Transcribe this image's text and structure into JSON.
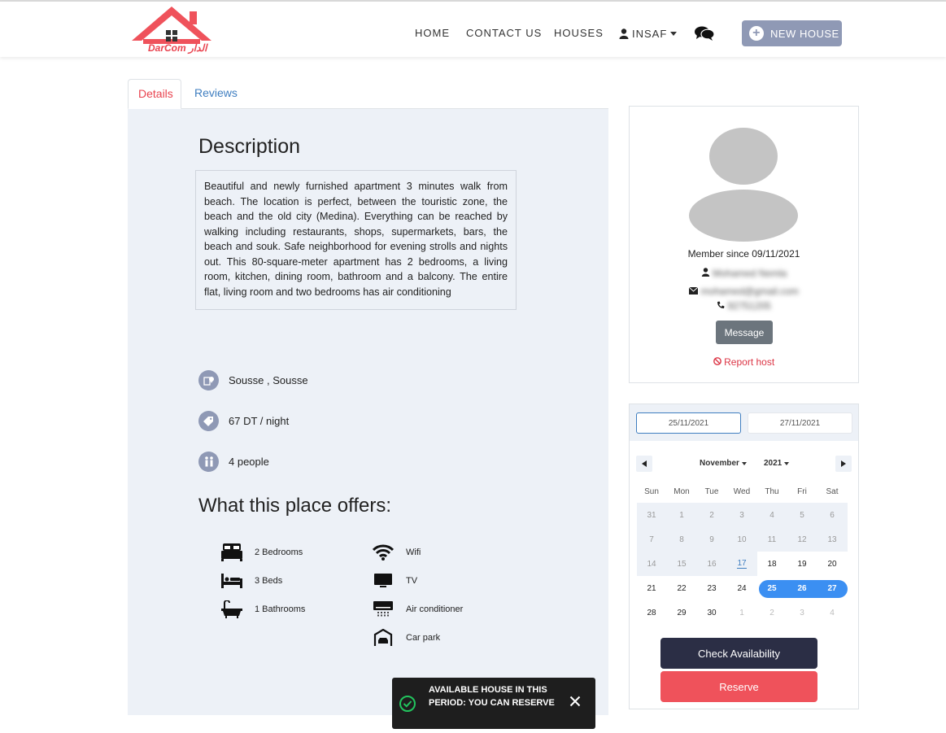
{
  "brand": {
    "logo_text": "DarCom الدار",
    "accent": "#e9434f"
  },
  "nav": {
    "home": "HOME",
    "contact": "CONTACT US",
    "houses": "HOUSES",
    "user": "INSAF",
    "new_house": "NEW HOUSE"
  },
  "tabs": {
    "details": "Details",
    "reviews": "Reviews"
  },
  "description": {
    "title": "Description",
    "text": "Beautiful and newly furnished apartment 3 minutes walk from beach. The location is perfect, between the touristic zone, the beach and the old city (Medina). Everything can be reached by walking including restaurants, shops, supermarkets, bars, the beach and souk. Safe neighborhood for evening strolls and nights out. This 80-square-meter apartment has 2 bedrooms, a living room, kitchen, dining room, bathroom and a balcony. The entire flat, living room and two bedrooms has air conditioning"
  },
  "info": {
    "location": "Sousse , Sousse",
    "price": "67 DT / night",
    "capacity": "4 people"
  },
  "offers": {
    "title": "What this place offers:",
    "left": [
      {
        "label": "2 Bedrooms",
        "icon": "bedroom-icon"
      },
      {
        "label": "3 Beds",
        "icon": "bed-icon"
      },
      {
        "label": "1 Bathrooms",
        "icon": "bathtub-icon"
      }
    ],
    "right": [
      {
        "label": "Wifi",
        "icon": "wifi-icon"
      },
      {
        "label": "TV",
        "icon": "tv-icon"
      },
      {
        "label": "Air conditioner",
        "icon": "air-conditioner-icon"
      },
      {
        "label": "Car park",
        "icon": "car-park-icon"
      }
    ]
  },
  "host": {
    "member_since": "Member since 09/11/2021",
    "name": "Mohamed Nemla",
    "email": "mohamed@gmail.com",
    "phone": "92751205",
    "message_btn": "Message",
    "report": "Report host"
  },
  "booking": {
    "start_date": "25/11/2021",
    "end_date": "27/11/2021",
    "month": "November",
    "year": "2021",
    "weekdays": [
      "Sun",
      "Mon",
      "Tue",
      "Wed",
      "Thu",
      "Fri",
      "Sat"
    ],
    "weeks": [
      [
        "31",
        "1",
        "2",
        "3",
        "4",
        "5",
        "6"
      ],
      [
        "7",
        "8",
        "9",
        "10",
        "11",
        "12",
        "13"
      ],
      [
        "14",
        "15",
        "16",
        "17",
        "18",
        "19",
        "20"
      ],
      [
        "21",
        "22",
        "23",
        "24",
        "25",
        "26",
        "27"
      ],
      [
        "28",
        "29",
        "30",
        "1",
        "2",
        "3",
        "4"
      ]
    ],
    "check_btn": "Check Availability",
    "reserve_btn": "Reserve",
    "selection_color": "#3b8ff2"
  },
  "toast": {
    "message": "AVAILABLE HOUSE IN THIS PERIOD: YOU CAN RESERVE",
    "status_color": "#22c55e"
  }
}
